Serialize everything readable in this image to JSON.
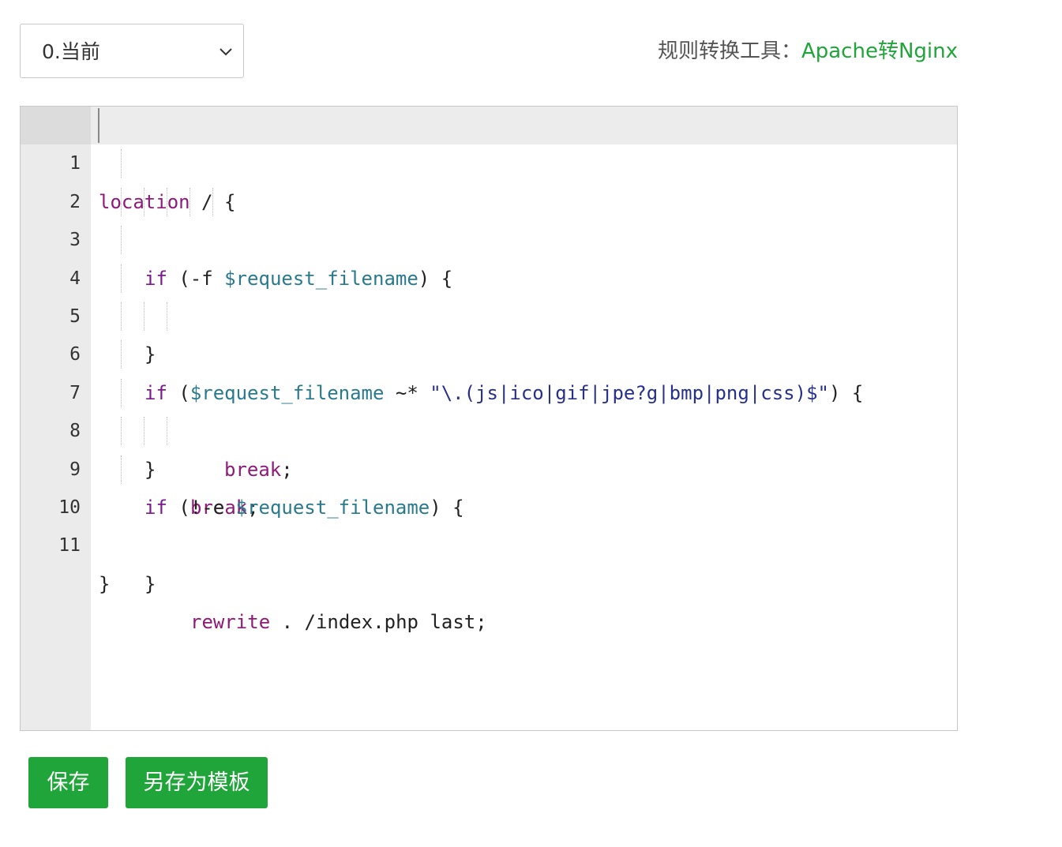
{
  "version_select": {
    "value": "0.当前"
  },
  "tool": {
    "label": "规则转换工具：",
    "link": "Apache转Nginx"
  },
  "editor": {
    "line_numbers": [
      "1",
      "2",
      "3",
      "4",
      "5",
      "6",
      "7",
      "8",
      "9",
      "10",
      "11"
    ],
    "lines": [
      [
        [
          "kw",
          "location"
        ],
        [
          "",
          " / {"
        ]
      ],
      [
        [
          "ctl",
          "if"
        ],
        [
          "",
          " (-f "
        ],
        [
          "var",
          "$request_filename"
        ],
        [
          "",
          ") {"
        ]
      ],
      [
        [
          "kw",
          "break"
        ],
        [
          "",
          ";"
        ]
      ],
      [
        [
          "",
          "}"
        ]
      ],
      [
        [
          "ctl",
          "if"
        ],
        [
          "",
          " ("
        ],
        [
          "var",
          "$request_filename"
        ],
        [
          "",
          " ~* "
        ],
        [
          "str",
          "\"\\.(js|ico|gif|jpe?g|bmp|png|css)$\""
        ],
        [
          "",
          ") {"
        ]
      ],
      [
        [
          "kw",
          "break"
        ],
        [
          "",
          ";"
        ]
      ],
      [
        [
          "",
          "}"
        ]
      ],
      [
        [
          "ctl",
          "if"
        ],
        [
          "",
          " (!-e "
        ],
        [
          "var",
          "$request_filename"
        ],
        [
          "",
          ") {"
        ]
      ],
      [
        [
          "kw",
          "rewrite"
        ],
        [
          "",
          " . /index.php last;"
        ]
      ],
      [
        [
          "",
          "}"
        ]
      ],
      [
        [
          "",
          "}"
        ]
      ]
    ]
  },
  "buttons": {
    "save": "保存",
    "save_as_template": "另存为模板"
  },
  "colors": {
    "accent": "#20a53a"
  }
}
